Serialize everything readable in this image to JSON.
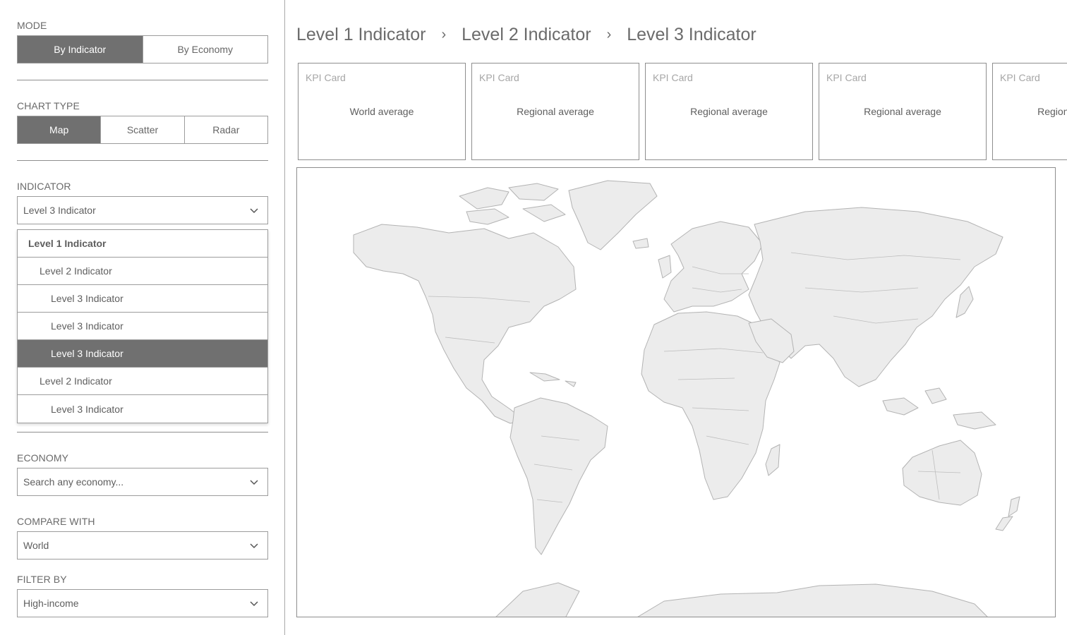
{
  "sidebar": {
    "mode": {
      "label": "MODE",
      "options": [
        "By Indicator",
        "By Economy"
      ],
      "selected": "By Indicator"
    },
    "chart_type": {
      "label": "CHART TYPE",
      "options": [
        "Map",
        "Scatter",
        "Radar"
      ],
      "selected": "Map"
    },
    "indicator": {
      "label": "INDICATOR",
      "value": "Level 3 Indicator",
      "dropdown_items": [
        {
          "label": "Level 1 Indicator",
          "level": 1,
          "selected": false
        },
        {
          "label": "Level 2 Indicator",
          "level": 2,
          "selected": false
        },
        {
          "label": "Level 3 Indicator",
          "level": 3,
          "selected": false
        },
        {
          "label": "Level 3 Indicator",
          "level": 3,
          "selected": false
        },
        {
          "label": "Level 3 Indicator",
          "level": 3,
          "selected": true
        },
        {
          "label": "Level 2 Indicator",
          "level": 2,
          "selected": false
        },
        {
          "label": "Level 3 Indicator",
          "level": 3,
          "selected": false
        }
      ]
    },
    "economy": {
      "label": "ECONOMY",
      "placeholder": "Search any economy..."
    },
    "compare_with": {
      "label": "COMPARE WITH",
      "value": "World"
    },
    "filter_by": {
      "label": "FILTER BY",
      "value": "High-income"
    }
  },
  "breadcrumb": [
    "Level 1 Indicator",
    "Level 2 Indicator",
    "Level 3 Indicator"
  ],
  "breadcrumb_separator": "›",
  "kpi_cards": [
    {
      "title": "KPI Card",
      "value": "World average"
    },
    {
      "title": "KPI Card",
      "value": "Regional average"
    },
    {
      "title": "KPI Card",
      "value": "Regional average"
    },
    {
      "title": "KPI Card",
      "value": "Regional average"
    },
    {
      "title": "KPI Card",
      "value": "Regional average"
    }
  ],
  "colors": {
    "accent": "#707070",
    "land": "#ececec",
    "land_stroke": "#b3b3b3",
    "border": "#9c9c9c"
  },
  "icons": {
    "dropdown": "chevron-down-icon",
    "separator": "chevron-right-icon"
  }
}
